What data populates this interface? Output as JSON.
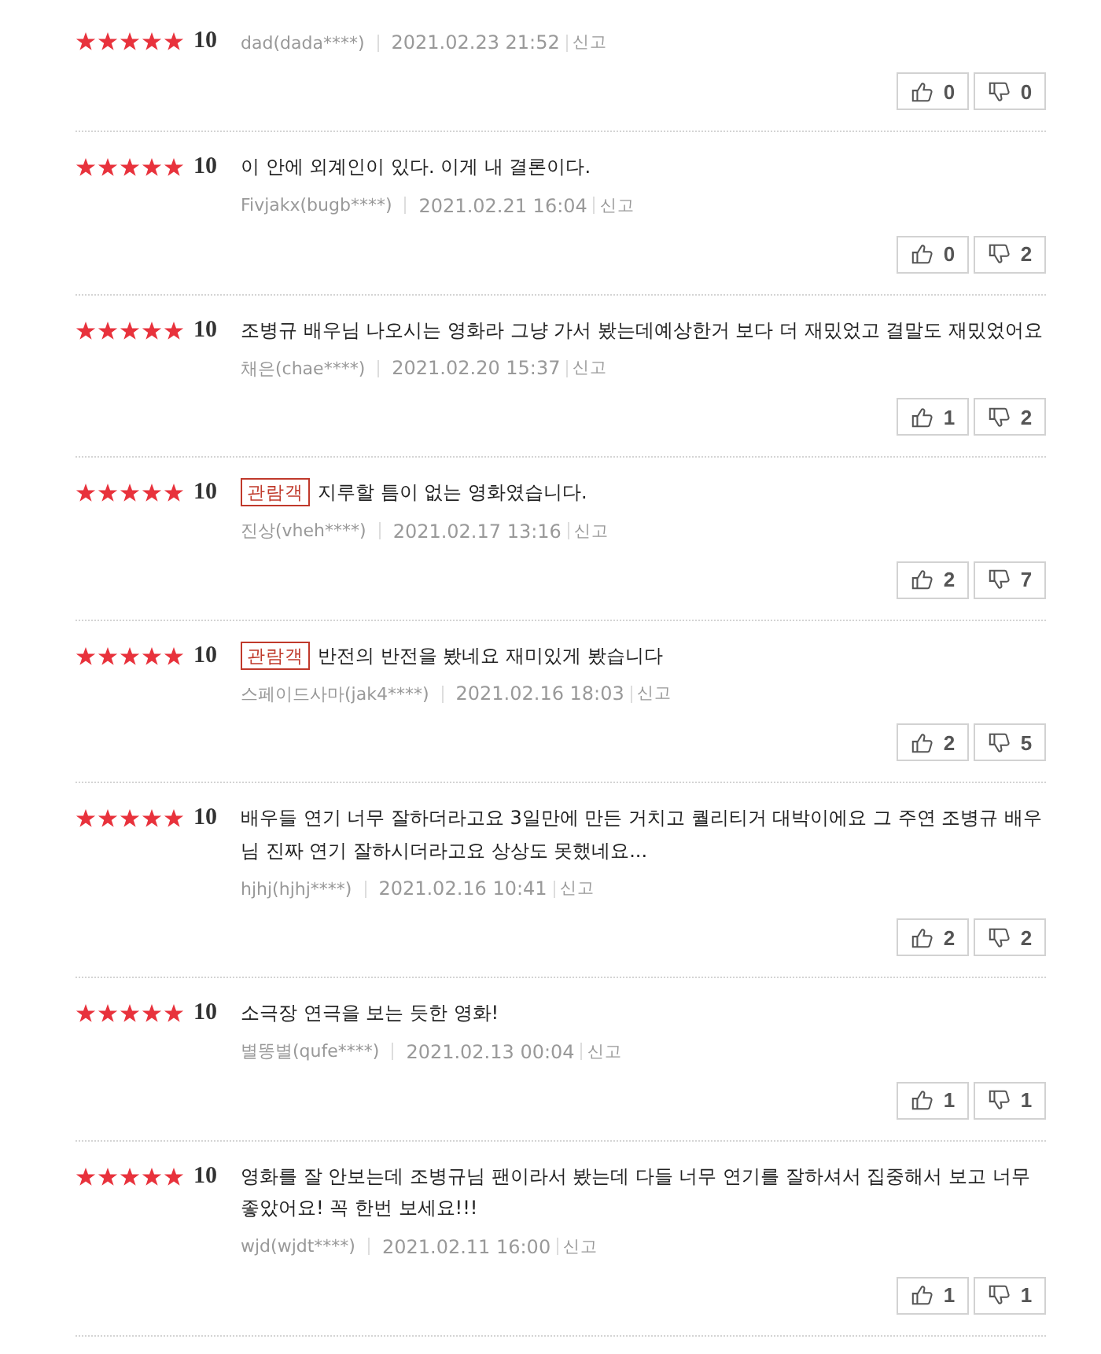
{
  "reviews": [
    {
      "stars": 5,
      "score": "10",
      "author": "dad(dada****)",
      "date": "2021.02.23 21:52",
      "report": "신고",
      "likes": "0",
      "dislikes": "0"
    },
    {
      "stars": 5,
      "score": "10",
      "comment": "이 안에 외계인이 있다. 이게 내 결론이다.",
      "author": "Fivjakx(bugb****)",
      "date": "2021.02.21 16:04",
      "report": "신고",
      "likes": "0",
      "dislikes": "2"
    },
    {
      "stars": 5,
      "score": "10",
      "comment": "조병규 배우님 나오시는 영화라 그냥 가서 봤는데예상한거 보다 더 재밌었고 결말도 재밌었어요",
      "author": "채은(chae****)",
      "date": "2021.02.20 15:37",
      "report": "신고",
      "likes": "1",
      "dislikes": "2"
    },
    {
      "stars": 5,
      "score": "10",
      "badge": "관람객",
      "comment": "지루할 틈이 없는 영화였습니다.",
      "author": "진상(vheh****)",
      "date": "2021.02.17 13:16",
      "report": "신고",
      "likes": "2",
      "dislikes": "7"
    },
    {
      "stars": 5,
      "score": "10",
      "badge": "관람객",
      "comment": "반전의 반전을 봤네요 재미있게 봤습니다",
      "author": "스페이드사마(jak4****)",
      "date": "2021.02.16 18:03",
      "report": "신고",
      "likes": "2",
      "dislikes": "5"
    },
    {
      "stars": 5,
      "score": "10",
      "comment": "배우들 연기 너무 잘하더라고요 3일만에 만든 거치고 퀄리티거 대박이에요 그 주연 조병규 배우님 진짜 연기 잘하시더라고요 상상도 못했네요...",
      "author": "hjhj(hjhj****)",
      "date": "2021.02.16 10:41",
      "report": "신고",
      "likes": "2",
      "dislikes": "2"
    },
    {
      "stars": 5,
      "score": "10",
      "comment": "소극장 연극을 보는 듯한 영화!",
      "author": "별똥별(qufe****)",
      "date": "2021.02.13 00:04",
      "report": "신고",
      "likes": "1",
      "dislikes": "1"
    },
    {
      "stars": 5,
      "score": "10",
      "comment": "영화를 잘 안보는데 조병규님 팬이라서 봤는데 다들 너무 연기를 잘하셔서 집중해서 보고 너무 좋았어요! 꼭 한번 보세요!!!",
      "author": "wjd(wjdt****)",
      "date": "2021.02.11 16:00",
      "report": "신고",
      "likes": "1",
      "dislikes": "1"
    }
  ]
}
